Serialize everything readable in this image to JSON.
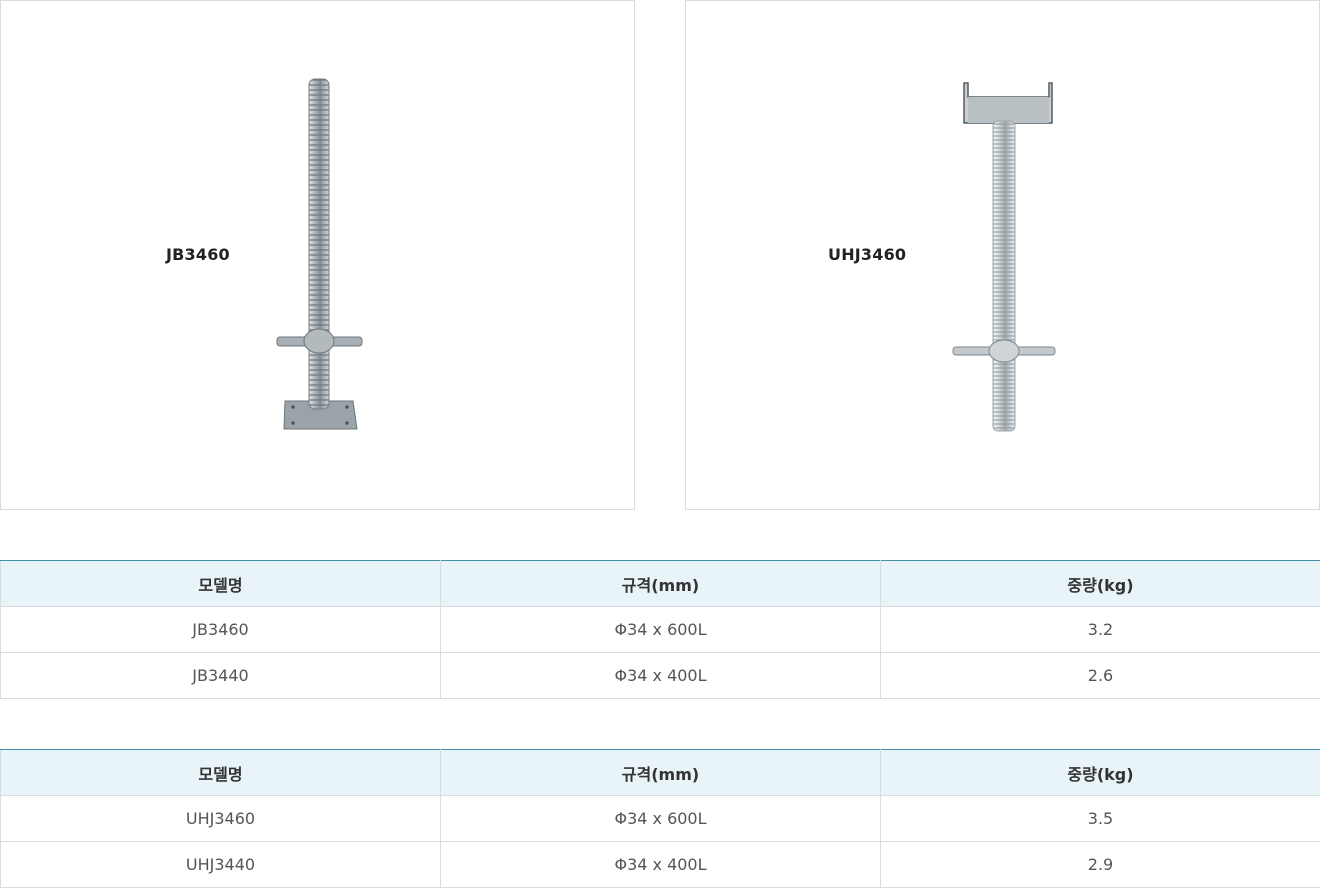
{
  "products": [
    {
      "name": "JB3460",
      "image_icon": "jack-base-icon"
    },
    {
      "name": "UHJ3460",
      "image_icon": "u-head-jack-icon"
    }
  ],
  "tables": [
    {
      "headers": [
        "모델명",
        "규격(mm)",
        "중량(kg)"
      ],
      "rows": [
        [
          "JB3460",
          "Φ34 x 600L",
          "3.2"
        ],
        [
          "JB3440",
          "Φ34 x 400L",
          "2.6"
        ]
      ]
    },
    {
      "headers": [
        "모델명",
        "규격(mm)",
        "중량(kg)"
      ],
      "rows": [
        [
          "UHJ3460",
          "Φ34 x 600L",
          "3.5"
        ],
        [
          "UHJ3440",
          "Φ34 x 400L",
          "2.9"
        ]
      ]
    }
  ],
  "colors": {
    "header_bg": "#e9f4f9",
    "header_top_border": "#3f8fa6",
    "panel_border": "#dcdcdc"
  }
}
